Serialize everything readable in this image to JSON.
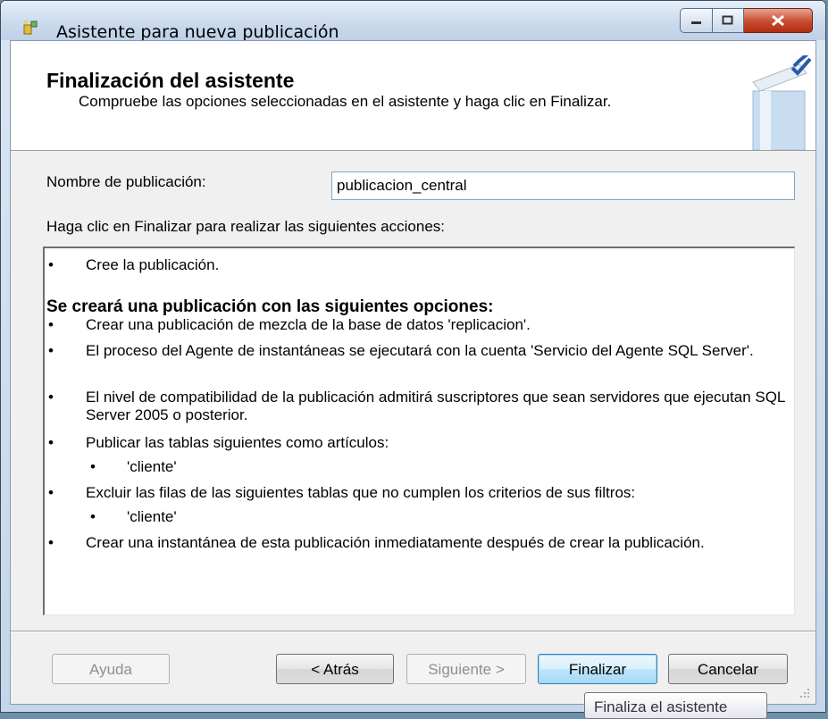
{
  "window": {
    "title": "Asistente para nueva publicación",
    "controls": {
      "minimize": "minimize",
      "maximize": "maximize",
      "close": "close"
    }
  },
  "header": {
    "title": "Finalización del asistente",
    "subtitle": "Compruebe las opciones seleccionadas en el asistente y haga clic en Finalizar."
  },
  "form": {
    "pub_name_label": "Nombre de publicación:",
    "pub_name_value": "publicacion_central",
    "actions_label": "Haga clic en Finalizar para realizar las siguientes acciones:"
  },
  "actions": {
    "item1": "Cree la publicación.",
    "section_title": "Se creará una publicación con las siguientes opciones:",
    "opt1": "Crear una publicación de mezcla de la base de datos 'replicacion'.",
    "opt2": "El proceso del Agente de instantáneas se ejecutará con la cuenta 'Servicio del Agente SQL Server'.",
    "opt3": "El nivel de compatibilidad de la publicación admitirá suscriptores que sean servidores que ejecutan SQL Server 2005 o posterior.",
    "opt4": "Publicar las tablas siguientes como artículos:",
    "opt4_sub": "'cliente'",
    "opt5": "Excluir las filas de las siguientes tablas que no cumplen los criterios de sus filtros:",
    "opt5_sub": "'cliente'",
    "opt6": "Crear una instantánea de esta publicación inmediatamente después de crear la publicación."
  },
  "buttons": {
    "help": "Ayuda",
    "back": "< Atrás",
    "next": "Siguiente >",
    "finish": "Finalizar",
    "cancel": "Cancelar"
  },
  "tooltip": "Finaliza el asistente",
  "icons": {
    "app": "wizard-app-icon",
    "header": "book-check-icon"
  }
}
